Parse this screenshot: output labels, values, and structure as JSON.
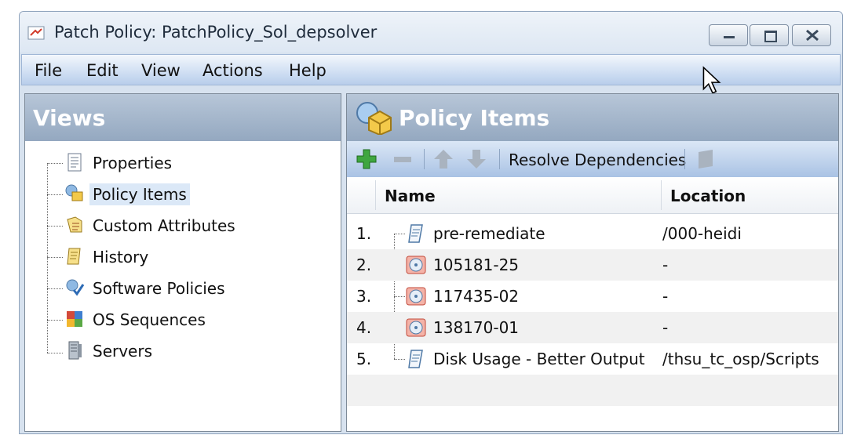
{
  "window": {
    "title": "Patch Policy: PatchPolicy_Sol_depsolver",
    "controls": [
      "minimize-icon",
      "maximize-icon",
      "close-icon"
    ]
  },
  "menu": [
    "File",
    "Edit",
    "View",
    "Actions",
    "Help"
  ],
  "views": {
    "title": "Views",
    "items": [
      {
        "label": "Properties",
        "icon": "properties-icon",
        "selected": false
      },
      {
        "label": "Policy Items",
        "icon": "policy-items-icon",
        "selected": true
      },
      {
        "label": "Custom Attributes",
        "icon": "custom-attributes-icon",
        "selected": false
      },
      {
        "label": "History",
        "icon": "history-icon",
        "selected": false
      },
      {
        "label": "Software Policies",
        "icon": "software-policies-icon",
        "selected": false
      },
      {
        "label": "OS Sequences",
        "icon": "os-sequences-icon",
        "selected": false
      },
      {
        "label": "Servers",
        "icon": "servers-icon",
        "selected": false
      }
    ]
  },
  "policy_items": {
    "title": "Policy Items",
    "toolbar": {
      "resolve_label": "Resolve Dependencies",
      "icons": [
        "add-icon",
        "remove-icon",
        "move-up-icon",
        "move-down-icon",
        "properties-icon"
      ]
    },
    "columns": [
      "Name",
      "Location"
    ],
    "rows": [
      {
        "num": "1.",
        "name": "pre-remediate",
        "location": "/000-heidi",
        "icon": "script-icon"
      },
      {
        "num": "2.",
        "name": "105181-25",
        "location": "-",
        "icon": "patch-icon"
      },
      {
        "num": "3.",
        "name": "117435-02",
        "location": "-",
        "icon": "patch-icon"
      },
      {
        "num": "4.",
        "name": "138170-01",
        "location": "-",
        "icon": "patch-icon"
      },
      {
        "num": "5.",
        "name": "Disk Usage - Better Output",
        "location": "/thsu_tc_osp/Scripts",
        "icon": "script-icon"
      }
    ]
  },
  "colors": {
    "header_gradient": "#94a8c0",
    "toolbar_blue": "#a9c2e4",
    "selected_bg": "#dbe8f7",
    "add_green": "#3fa63f"
  }
}
